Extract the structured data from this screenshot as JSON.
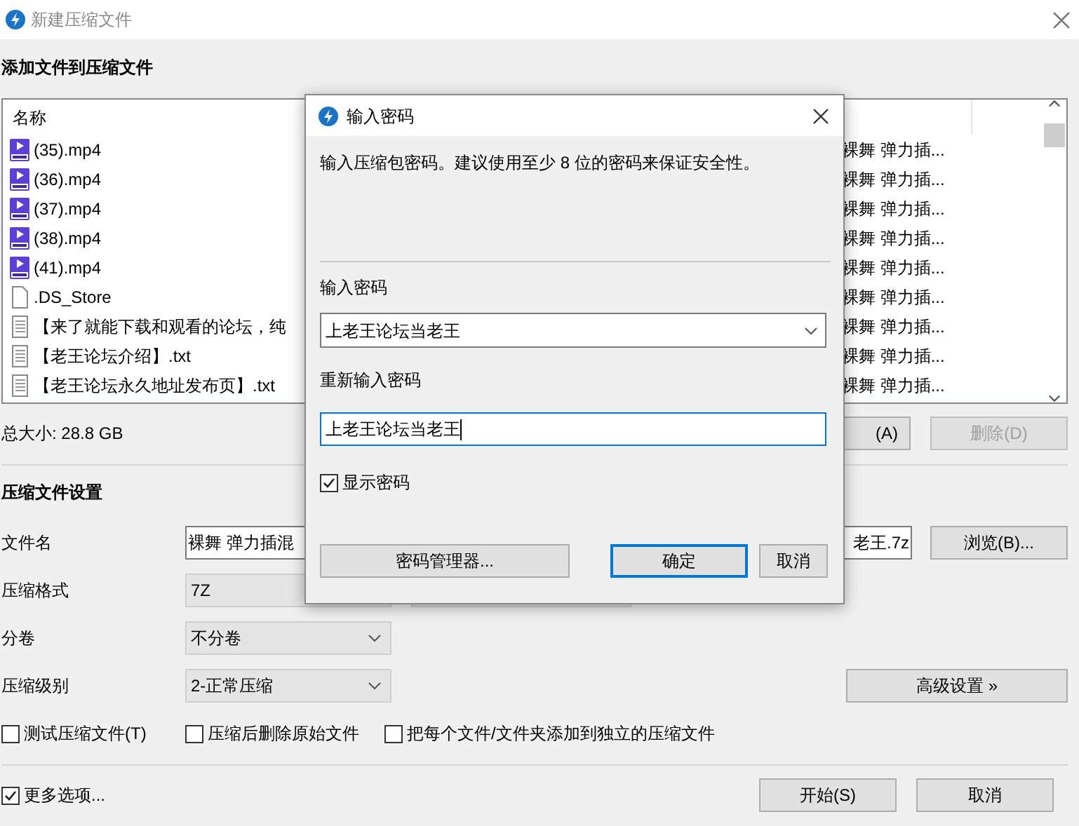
{
  "window": {
    "title": "新建压缩文件"
  },
  "add_section": {
    "heading": "添加文件到压缩文件"
  },
  "file_list": {
    "columns": [
      "名称"
    ],
    "rows": [
      {
        "kind": "video",
        "name": "(35).mp4",
        "column_2": "裸舞 弹力插..."
      },
      {
        "kind": "video",
        "name": "(36).mp4",
        "column_2": "裸舞 弹力插..."
      },
      {
        "kind": "video",
        "name": "(37).mp4",
        "column_2": "裸舞 弹力插..."
      },
      {
        "kind": "video",
        "name": "(38).mp4",
        "column_2": "裸舞 弹力插..."
      },
      {
        "kind": "video",
        "name": "(41).mp4",
        "column_2": "裸舞 弹力插..."
      },
      {
        "kind": "file",
        "name": ".DS_Store",
        "column_2": "裸舞 弹力插..."
      },
      {
        "kind": "text",
        "name": "【来了就能下载和观看的论坛，纯",
        "column_2": "裸舞 弹力插..."
      },
      {
        "kind": "text",
        "name": "【老王论坛介绍】.txt",
        "column_2": "裸舞 弹力插..."
      },
      {
        "kind": "text",
        "name": "【老王论坛永久地址发布页】.txt",
        "column_2": "裸舞 弹力插..."
      }
    ]
  },
  "total_size": "总大小: 28.8 GB",
  "list_buttons": [
    {
      "label": "(A)",
      "disabled": false
    },
    {
      "label": "删除(D)",
      "disabled": true
    }
  ],
  "settings": {
    "heading": "压缩文件设置",
    "file_name": {
      "label": "文件名",
      "value_start": "裸舞 弹力插混",
      "value_end": "老王.7z",
      "button": "浏览(B)..."
    },
    "format": {
      "label": "压缩格式",
      "value": "7Z"
    },
    "split": {
      "label": "分卷",
      "value": "不分卷"
    },
    "level": {
      "label": "压缩级别",
      "value": "2-正常压缩",
      "button": "高级设置 »"
    },
    "options": [
      {
        "label": "测试压缩文件(T)",
        "checked": false
      },
      {
        "label": "压缩后删除原始文件",
        "checked": false
      },
      {
        "label": "把每个文件/文件夹添加到独立的压缩文件",
        "checked": false
      }
    ]
  },
  "more_options": {
    "label": "更多选项...",
    "checked": true
  },
  "footer_buttons": [
    "开始(S)",
    "取消"
  ],
  "password_dialog": {
    "title": "输入密码",
    "hint": "输入压缩包密码。建议使用至少 8 位的密码来保证安全性。",
    "password_label": "输入密码",
    "password": "上老王论坛当老王",
    "confirm_label": "重新输入密码",
    "confirm": "上老王论坛当老王",
    "show_password": {
      "label": "显示密码",
      "checked": true
    },
    "buttons": [
      "密码管理器...",
      "确定",
      "取消"
    ]
  }
}
